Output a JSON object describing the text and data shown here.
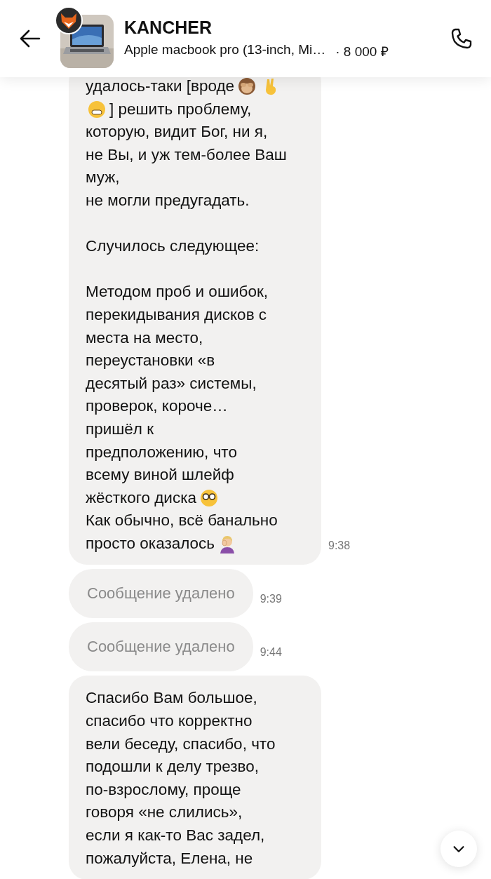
{
  "header": {
    "title": "KANCHER",
    "listing": "Apple macbook pro (13-inch, Mi…",
    "price": "· 8 000 ₽"
  },
  "messages": [
    {
      "kind": "text",
      "time": "9:38",
      "paragraphs": [
        [
          [
            {
              "kind": "text",
              "text": "удалось-таки [вроде"
            },
            {
              "kind": "emoji"
            },
            {
              "kind": "emoji"
            }
          ],
          [
            {
              "kind": "emoji"
            },
            {
              "kind": "text",
              "text": "] решить проблему,"
            }
          ],
          [
            {
              "kind": "text",
              "text": "которую, видит Бог, ни я,"
            }
          ],
          [
            {
              "kind": "text",
              "text": "не Вы, и уж тем-более Ваш"
            }
          ],
          [
            {
              "kind": "text",
              "text": "муж,"
            }
          ],
          [
            {
              "kind": "text",
              "text": "не могли предугадать."
            }
          ]
        ],
        [
          [
            {
              "kind": "text",
              "text": "Случилось следующее:"
            }
          ]
        ],
        [
          [
            {
              "kind": "text",
              "text": "Методом проб и ошибок,"
            }
          ],
          [
            {
              "kind": "text",
              "text": "перекидывания дисков с"
            }
          ],
          [
            {
              "kind": "text",
              "text": "места на место,"
            }
          ],
          [
            {
              "kind": "text",
              "text": "переустановки «в"
            }
          ],
          [
            {
              "kind": "text",
              "text": "десятый раз» системы,"
            }
          ],
          [
            {
              "kind": "text",
              "text": "проверок, короче…"
            }
          ],
          [
            {
              "kind": "text",
              "text": "пришёл к"
            }
          ],
          [
            {
              "kind": "text",
              "text": "предположению, что"
            }
          ],
          [
            {
              "kind": "text",
              "text": "всему виной шлейф"
            }
          ],
          [
            {
              "kind": "text",
              "text": "жёсткого диска"
            },
            {
              "kind": "emoji"
            }
          ],
          [
            {
              "kind": "text",
              "text": "Как обычно, всё банально"
            }
          ],
          [
            {
              "kind": "text",
              "text": "просто оказалось"
            },
            {
              "kind": "emoji"
            }
          ]
        ]
      ]
    },
    {
      "kind": "deleted",
      "text": "Сообщение удалено",
      "time": "9:39"
    },
    {
      "kind": "deleted",
      "text": "Сообщение удалено",
      "time": "9:44"
    },
    {
      "kind": "text",
      "paragraphs": [
        [
          [
            {
              "kind": "text",
              "text": "Спасибо Вам большое,"
            }
          ],
          [
            {
              "kind": "text",
              "text": "спасибо что корректно"
            }
          ],
          [
            {
              "kind": "text",
              "text": "вели беседу, спасибо, что"
            }
          ],
          [
            {
              "kind": "text",
              "text": "подошли к делу трезво,"
            }
          ],
          [
            {
              "kind": "text",
              "text": "по-взрослому, проще"
            }
          ],
          [
            {
              "kind": "text",
              "text": "говоря «не слились»,"
            }
          ],
          [
            {
              "kind": "text",
              "text": "если я как-то Вас задел,"
            }
          ],
          [
            {
              "kind": "text",
              "text": "пожалуйста, Елена, не"
            }
          ]
        ]
      ]
    }
  ]
}
